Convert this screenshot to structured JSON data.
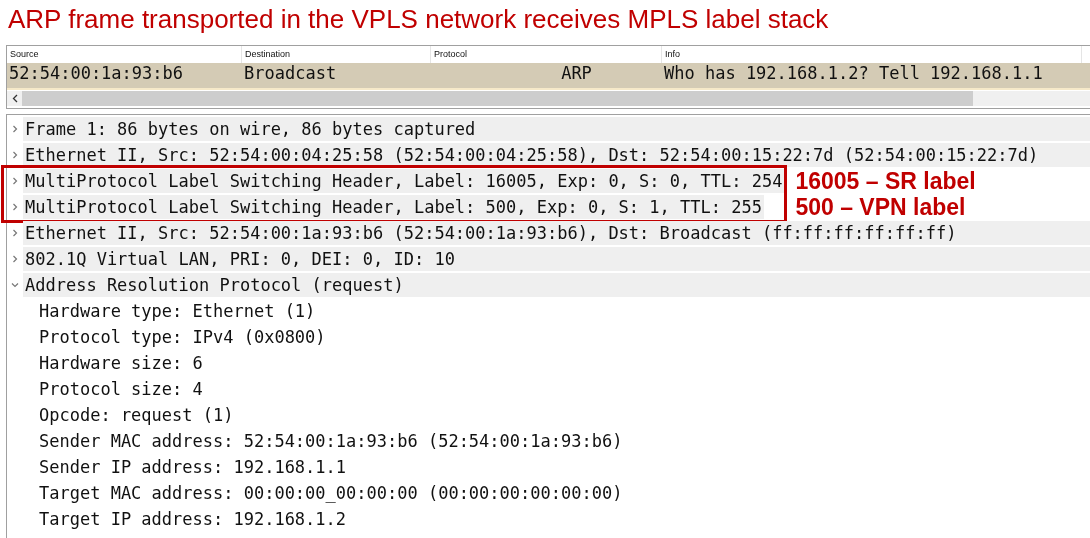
{
  "title": "ARP frame transported in the VPLS network receives MPLS label stack",
  "packet_list": {
    "columns": [
      "Source",
      "Destination",
      "Protocol",
      "Info"
    ],
    "rows": [
      {
        "cells": [
          "52:54:00:1a:93:b6",
          "Broadcast",
          "ARP",
          "Who has 192.168.1.2? Tell 192.168.1.1"
        ],
        "selected": true
      }
    ]
  },
  "details": {
    "items": [
      {
        "text": "Frame 1: 86 bytes on wire, 86 bytes captured",
        "expanded": false,
        "boxed": false
      },
      {
        "text": "Ethernet II, Src: 52:54:00:04:25:58 (52:54:00:04:25:58), Dst: 52:54:00:15:22:7d (52:54:00:15:22:7d)",
        "expanded": false,
        "boxed": false
      },
      {
        "text": "MultiProtocol Label Switching Header, Label: 16005, Exp: 0, S: 0, TTL: 254",
        "expanded": false,
        "boxed": true,
        "note": "16005 – SR label"
      },
      {
        "text": "MultiProtocol Label Switching Header, Label: 500, Exp: 0, S: 1, TTL: 255",
        "expanded": false,
        "boxed": true,
        "note": "500 – VPN label"
      },
      {
        "text": "Ethernet II, Src: 52:54:00:1a:93:b6 (52:54:00:1a:93:b6), Dst: Broadcast (ff:ff:ff:ff:ff:ff)",
        "expanded": false,
        "boxed": false
      },
      {
        "text": "802.1Q Virtual LAN, PRI: 0, DEI: 0, ID: 10",
        "expanded": false,
        "boxed": false
      },
      {
        "text": "Address Resolution Protocol (request)",
        "expanded": true,
        "boxed": false,
        "children": [
          {
            "text": "Hardware type: Ethernet (1)"
          },
          {
            "text": "Protocol type: IPv4 (0x0800)"
          },
          {
            "text": "Hardware size: 6"
          },
          {
            "text": "Protocol size: 4"
          },
          {
            "text": "Opcode: request (1)"
          },
          {
            "text": "Sender MAC address: 52:54:00:1a:93:b6 (52:54:00:1a:93:b6)"
          },
          {
            "text": "Sender IP address: 192.168.1.1"
          },
          {
            "text": "Target MAC address: 00:00:00_00:00:00 (00:00:00:00:00:00)"
          },
          {
            "text": "Target IP address: 192.168.1.2"
          }
        ]
      }
    ]
  }
}
